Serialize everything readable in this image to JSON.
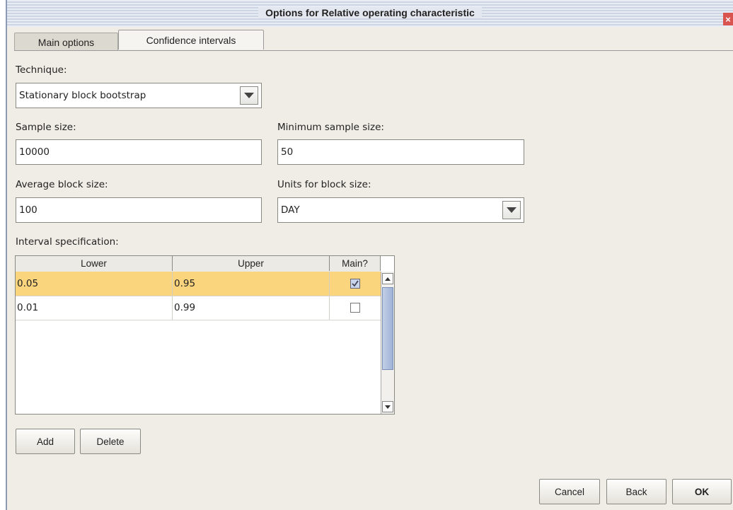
{
  "window": {
    "title": "Options for Relative operating characteristic",
    "close_glyph": "×"
  },
  "tabs": [
    {
      "label": "Main options",
      "active": false
    },
    {
      "label": "Confidence intervals",
      "active": true
    }
  ],
  "form": {
    "technique_label": "Technique:",
    "technique_value": "Stationary block bootstrap",
    "sample_size_label": "Sample size:",
    "sample_size_value": "10000",
    "min_sample_size_label": "Minimum sample size:",
    "min_sample_size_value": "50",
    "avg_block_size_label": "Average block size:",
    "avg_block_size_value": "100",
    "units_label": "Units for block size:",
    "units_value": "DAY",
    "interval_spec_label": "Interval specification:"
  },
  "table": {
    "columns": [
      "Lower",
      "Upper",
      "Main?"
    ],
    "rows": [
      {
        "lower": "0.05",
        "upper": "0.95",
        "main": true
      },
      {
        "lower": "0.01",
        "upper": "0.99",
        "main": false
      }
    ]
  },
  "buttons": {
    "add": "Add",
    "delete": "Delete",
    "cancel": "Cancel",
    "back": "Back",
    "ok": "OK"
  },
  "colors": {
    "selected_row": "#fbd57e",
    "dialog_bg": "#efede6",
    "close_button": "#d9534f"
  }
}
